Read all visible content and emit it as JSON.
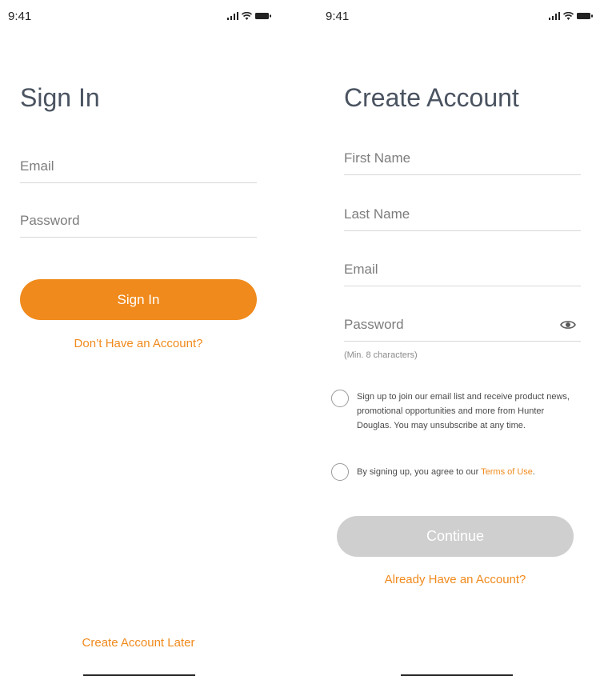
{
  "status_bar": {
    "time": "9:41"
  },
  "sign_in": {
    "title": "Sign In",
    "email_placeholder": "Email",
    "password_placeholder": "Password",
    "sign_in_button": "Sign In",
    "no_account_link": "Don’t Have an Account?",
    "create_later_link": "Create Account Later"
  },
  "create_account": {
    "title": "Create Account",
    "first_name_placeholder": "First Name",
    "last_name_placeholder": "Last Name",
    "email_placeholder": "Email",
    "password_placeholder": "Password",
    "password_hint": "(Min. 8 characters)",
    "email_list_consent": "Sign up to join our email list and receive product news, promotional opportunities and more from Hunter Douglas. You may unsubscribe at any time.",
    "terms_prefix": "By signing up, you agree to our ",
    "terms_link": "Terms of Use",
    "terms_suffix": ".",
    "continue_button": "Continue",
    "have_account_link": "Already Have an Account?"
  },
  "colors": {
    "accent": "#f08a1c",
    "disabled_button": "#cfcfcf",
    "title": "#4a5360"
  },
  "icons": [
    "signal-icon",
    "wifi-icon",
    "battery-icon",
    "eye-icon"
  ]
}
